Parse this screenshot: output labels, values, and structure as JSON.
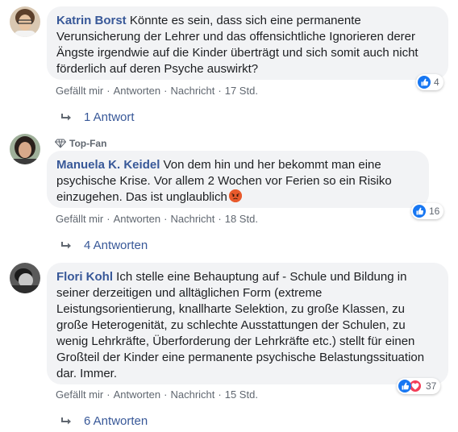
{
  "comments": [
    {
      "author": "Katrin Borst",
      "text": "Könnte es sein, dass sich eine permanente\nVerunsicherung der Lehrer und das offensichtliche Ignorieren derer\nÄngste irgendwie auf die Kinder überträgt und sich somit auch nicht\nförderlich auf deren Psyche auswirkt?",
      "actions": {
        "like": "Gefällt mir",
        "reply": "Antworten",
        "message": "Nachricht",
        "time": "17 Std."
      },
      "reaction_count": "4",
      "replies_label": "1 Antwort",
      "avatar_colors": {
        "bg": "#d8c3a8",
        "hair": "#6b4c35",
        "skin": "#e9c7a7"
      }
    },
    {
      "badge": "Top-Fan",
      "author": "Manuela K. Keidel",
      "text": "Von dem hin und her bekommt man eine\npsychische Krise. Vor allem 2 Wochen vor Ferien so ein Risiko\neinzugehen. Das ist unglaublich",
      "actions": {
        "like": "Gefällt mir",
        "reply": "Antworten",
        "message": "Nachricht",
        "time": "18 Std."
      },
      "reaction_count": "16",
      "replies_label": "4 Antworten",
      "avatar_colors": {
        "bg": "#a7b4a0",
        "hair": "#2b2220",
        "skin": "#d7a98a"
      }
    },
    {
      "author": "Flori Kohl",
      "text": "Ich stelle eine Behauptung auf - Schule und Bildung in\nseiner derzeitigen und alltäglichen Form (extreme\nLeistungsorientierung, knallharte Selektion, zu große Klassen, zu\ngroße Heterogenität, zu schlechte Ausstattungen der Schulen, zu\nwenig Lehrkräfte, Überforderung der Lehrkräfte etc.) stellt für einen\nGroßteil der Kinder eine permanente psychische Belastungssituation\ndar. Immer.",
      "actions": {
        "like": "Gefällt mir",
        "reply": "Antworten",
        "message": "Nachricht",
        "time": "15 Std."
      },
      "reaction_count": "37",
      "replies_label": "6 Antworten",
      "avatar_colors": {
        "bg": "#6d6d6d",
        "hair": "#1a1a1a",
        "skin": "#bdbdbd"
      }
    }
  ],
  "colors": {
    "link": "#385898",
    "bubble": "#f2f3f5",
    "meta": "#606770",
    "like": "#1877f2",
    "love": "#f33e58"
  },
  "icons": {
    "like": "thumbs-up-icon",
    "love": "heart-icon",
    "reply_arrow": "reply-arrow-icon",
    "badge": "diamond-icon",
    "emoji": "angry-face-icon"
  }
}
